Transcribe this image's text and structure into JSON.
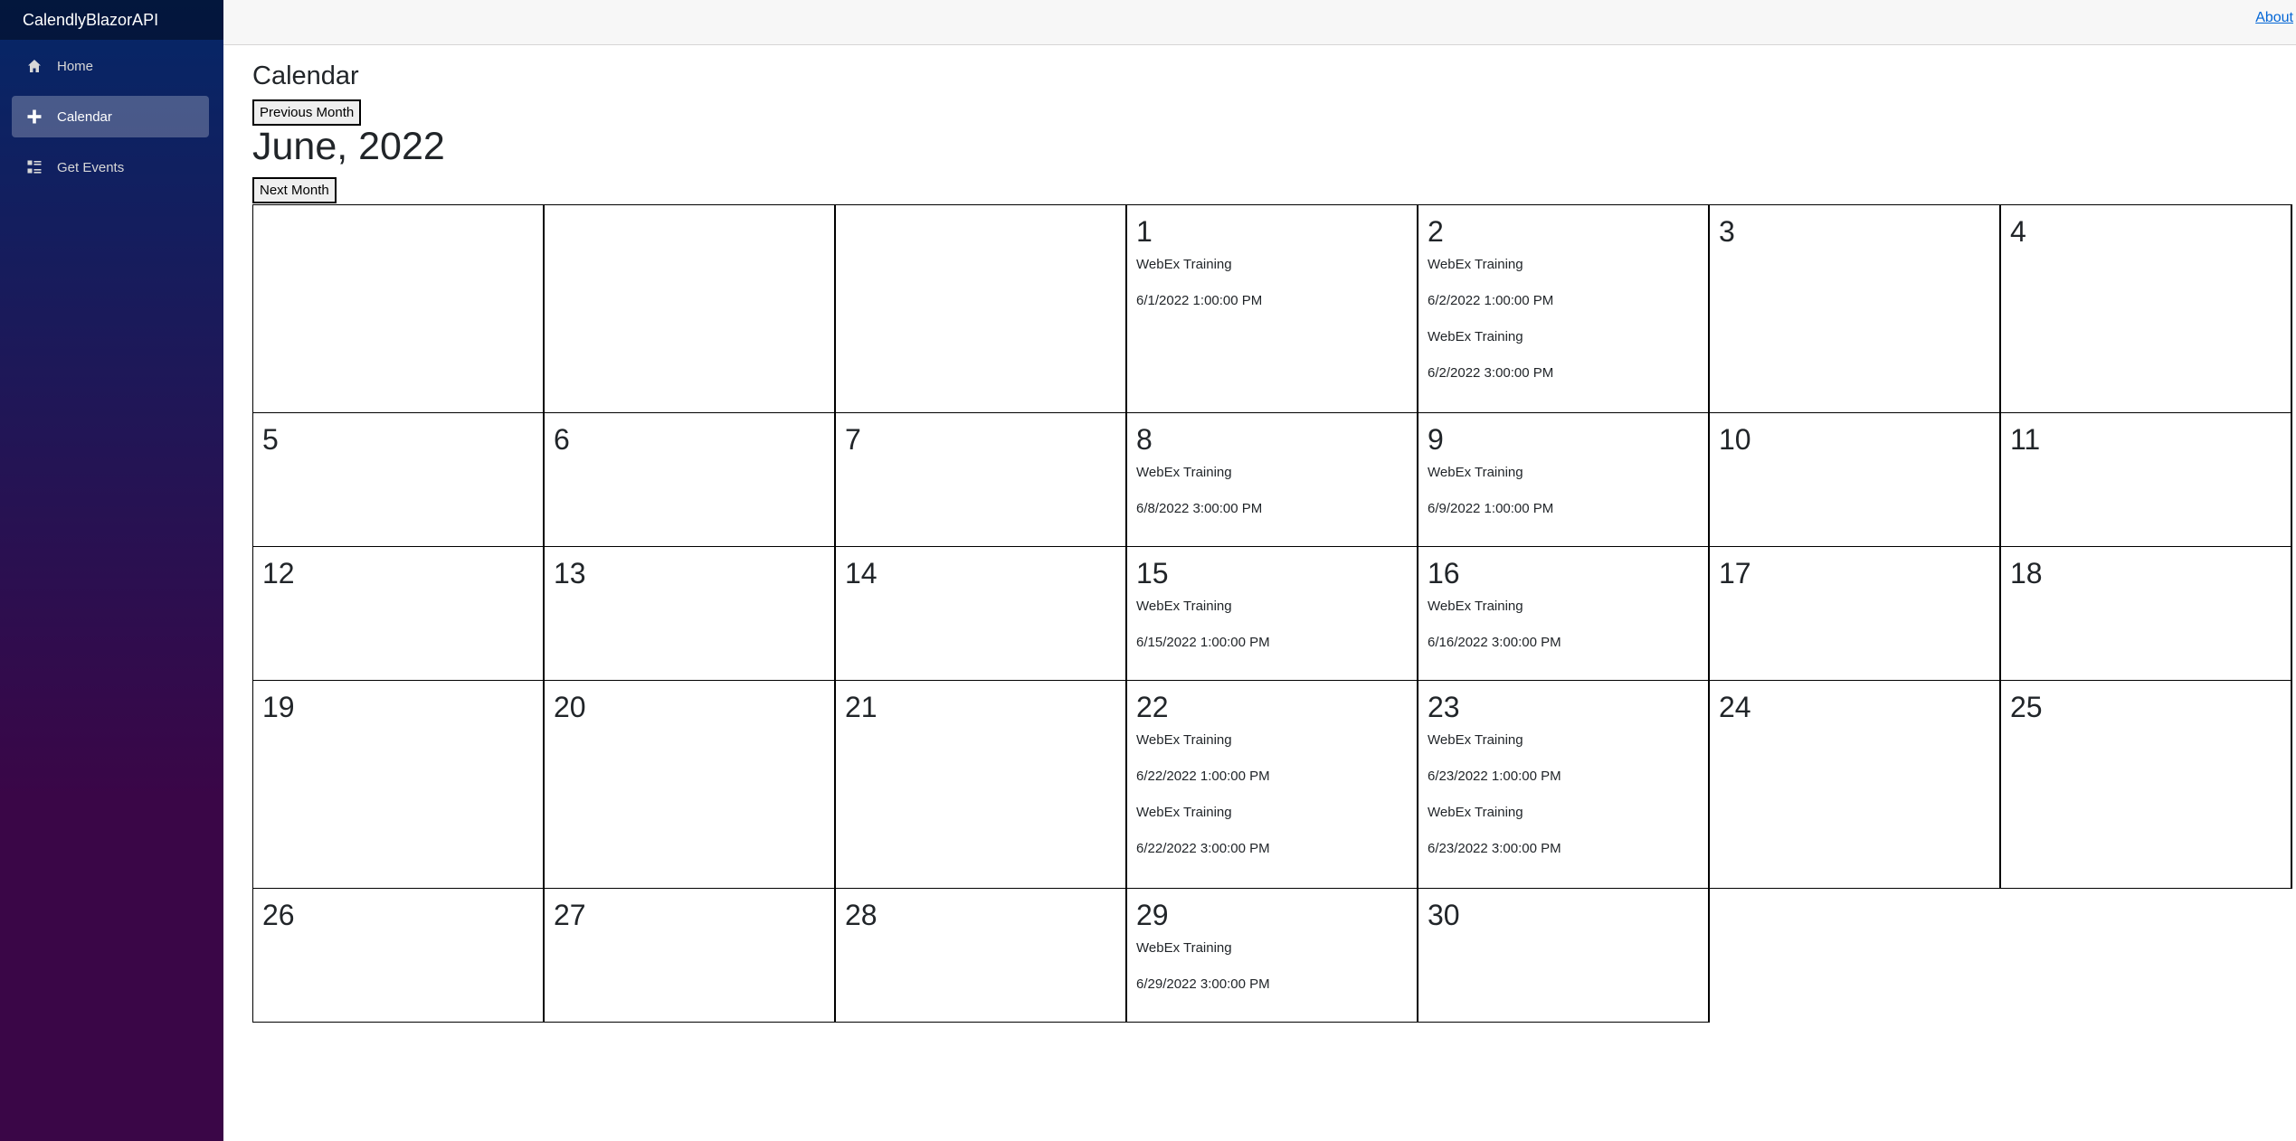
{
  "brand": "CalendlyBlazorAPI",
  "nav": {
    "items": [
      {
        "label": "Home",
        "icon": "home-icon"
      },
      {
        "label": "Calendar",
        "icon": "plus-icon",
        "active": true
      },
      {
        "label": "Get Events",
        "icon": "list-rich-icon"
      }
    ]
  },
  "top_row": {
    "about_label": "About"
  },
  "page": {
    "title": "Calendar",
    "prev_button": "Previous Month",
    "month_title": "June, 2022",
    "next_button": "Next Month"
  },
  "calendar": {
    "weeks": [
      {
        "days": [
          {
            "num": "",
            "events": []
          },
          {
            "num": "",
            "events": []
          },
          {
            "num": "",
            "events": []
          },
          {
            "num": "1",
            "events": [
              {
                "name": "WebEx Training",
                "time": "6/1/2022 1:00:00 PM"
              }
            ]
          },
          {
            "num": "2",
            "events": [
              {
                "name": "WebEx Training",
                "time": "6/2/2022 1:00:00 PM"
              },
              {
                "name": "WebEx Training",
                "time": "6/2/2022 3:00:00 PM"
              }
            ]
          },
          {
            "num": "3",
            "events": []
          },
          {
            "num": "4",
            "events": []
          }
        ]
      },
      {
        "days": [
          {
            "num": "5",
            "events": []
          },
          {
            "num": "6",
            "events": []
          },
          {
            "num": "7",
            "events": []
          },
          {
            "num": "8",
            "events": [
              {
                "name": "WebEx Training",
                "time": "6/8/2022 3:00:00 PM"
              }
            ]
          },
          {
            "num": "9",
            "events": [
              {
                "name": "WebEx Training",
                "time": "6/9/2022 1:00:00 PM"
              }
            ]
          },
          {
            "num": "10",
            "events": []
          },
          {
            "num": "11",
            "events": []
          }
        ]
      },
      {
        "days": [
          {
            "num": "12",
            "events": []
          },
          {
            "num": "13",
            "events": []
          },
          {
            "num": "14",
            "events": []
          },
          {
            "num": "15",
            "events": [
              {
                "name": "WebEx Training",
                "time": "6/15/2022 1:00:00 PM"
              }
            ]
          },
          {
            "num": "16",
            "events": [
              {
                "name": "WebEx Training",
                "time": "6/16/2022 3:00:00 PM"
              }
            ]
          },
          {
            "num": "17",
            "events": []
          },
          {
            "num": "18",
            "events": []
          }
        ]
      },
      {
        "days": [
          {
            "num": "19",
            "events": []
          },
          {
            "num": "20",
            "events": []
          },
          {
            "num": "21",
            "events": []
          },
          {
            "num": "22",
            "events": [
              {
                "name": "WebEx Training",
                "time": "6/22/2022 1:00:00 PM"
              },
              {
                "name": "WebEx Training",
                "time": "6/22/2022 3:00:00 PM"
              }
            ]
          },
          {
            "num": "23",
            "events": [
              {
                "name": "WebEx Training",
                "time": "6/23/2022 1:00:00 PM"
              },
              {
                "name": "WebEx Training",
                "time": "6/23/2022 3:00:00 PM"
              }
            ]
          },
          {
            "num": "24",
            "events": []
          },
          {
            "num": "25",
            "events": []
          }
        ]
      },
      {
        "days": [
          {
            "num": "26",
            "events": []
          },
          {
            "num": "27",
            "events": []
          },
          {
            "num": "28",
            "events": []
          },
          {
            "num": "29",
            "events": [
              {
                "name": "WebEx Training",
                "time": "6/29/2022 3:00:00 PM"
              }
            ]
          },
          {
            "num": "30",
            "events": []
          }
        ]
      }
    ]
  }
}
